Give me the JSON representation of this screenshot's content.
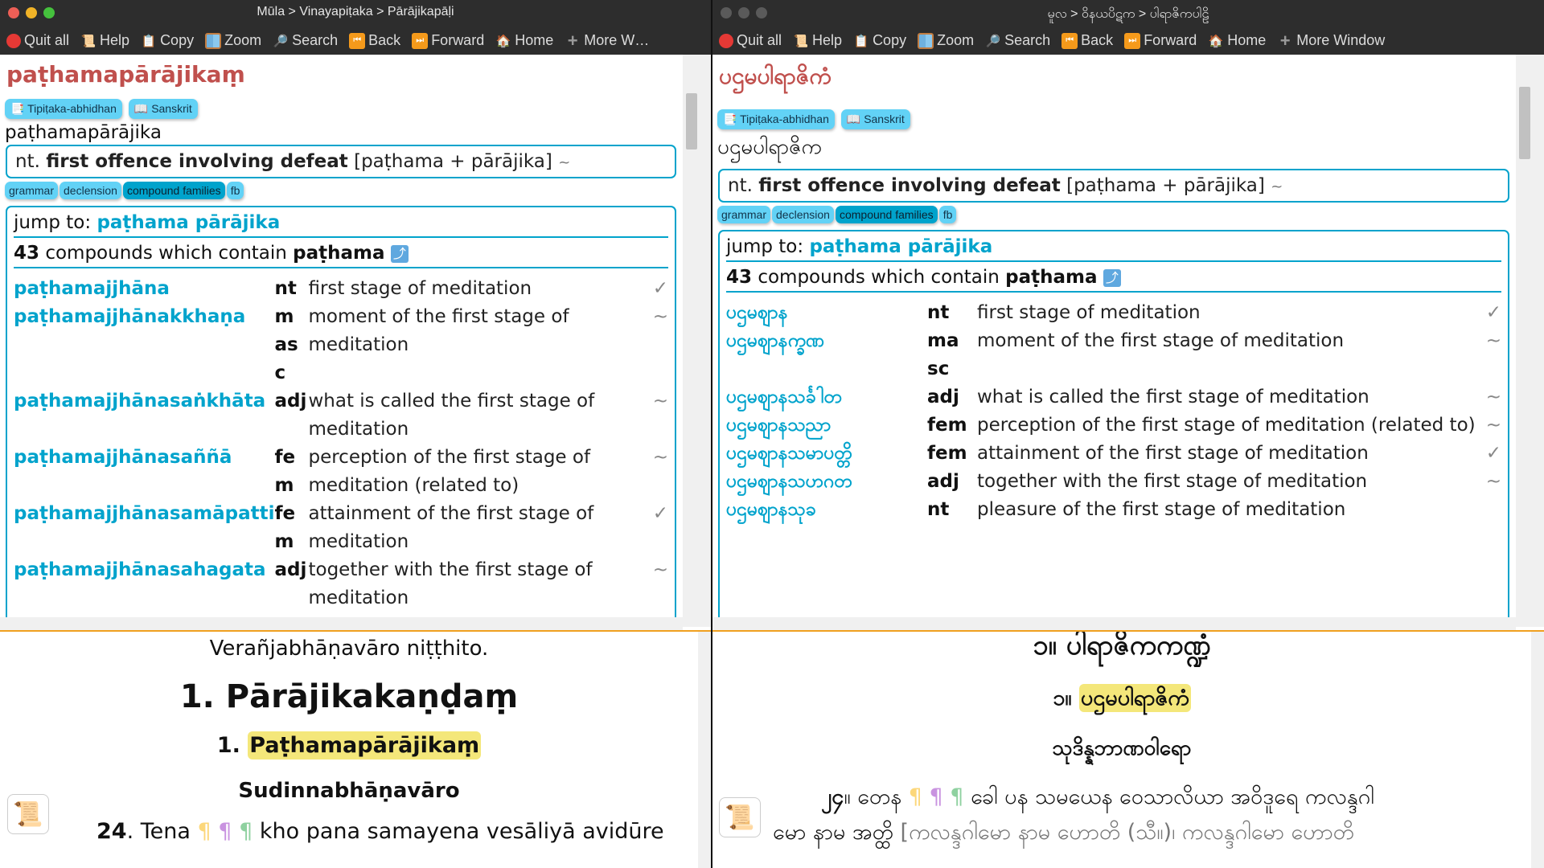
{
  "left": {
    "title": "Mūla > Vinayapiṭaka > Pārājikapāḷi",
    "toolbar": [
      "Quit all",
      "Help",
      "Copy",
      "Zoom",
      "Search",
      "Back",
      "Forward",
      "Home",
      "More W…"
    ],
    "headword": "paṭhamapārājikaṃ",
    "sources": [
      "Tipiṭaka-abhidhan",
      "Sanskrit"
    ],
    "lemma": "paṭhamapārājika",
    "meaning": {
      "pos": "nt.",
      "def": "first offence involving defeat",
      "construction": "[paṭhama + pārājika]",
      "tilde": "~"
    },
    "tabs": [
      "grammar",
      "declension",
      "compound families",
      "fb"
    ],
    "active_tab": "compound families",
    "jump_label": "jump to:",
    "jump_link": "paṭhama pārājika",
    "count": "43",
    "count_text": "compounds which contain",
    "count_word": "paṭhama",
    "compounds": [
      {
        "word": "paṭhamajjhāna",
        "pos": "nt",
        "meaning": "first stage of meditation",
        "mark": "✓"
      },
      {
        "word": "paṭhamajjhānakkhaṇa",
        "pos": "m\nas\nc",
        "meaning": "moment of the first stage of meditation",
        "mark": "~"
      },
      {
        "word": "paṭhamajjhānasaṅkhāta",
        "pos": "adj",
        "meaning": "what is called the first stage of meditation",
        "mark": "~"
      },
      {
        "word": "paṭhamajjhānasaññā",
        "pos": "fe\nm",
        "meaning": "perception of the first stage of meditation (related to)",
        "mark": "~"
      },
      {
        "word": "paṭhamajjhānasamāpatti",
        "pos": "fe\nm",
        "meaning": "attainment of the first stage of meditation",
        "mark": "✓"
      },
      {
        "word": "paṭhamajjhānasahagata",
        "pos": "adj",
        "meaning": "together with the first stage of meditation",
        "mark": "~"
      }
    ],
    "reader": {
      "line1": "Verañjabhāṇavāro niṭṭhito.",
      "h1": "1. Pārājikakaṇḍaṃ",
      "h2_num": "1.",
      "h2_hl": "Paṭhamapārājikaṃ",
      "h3": "Sudinnabhāṇavāro",
      "para_num": "24",
      "para_word": ". Tena",
      "para_rest": "kho pana samayena vesāliyā avidūre",
      "para_line2": ""
    }
  },
  "right": {
    "title": "မူလ > ဝိနယပိဋက > ပါရာဇိကပါဠိ",
    "toolbar": [
      "Quit all",
      "Help",
      "Copy",
      "Zoom",
      "Search",
      "Back",
      "Forward",
      "Home",
      "More Window"
    ],
    "headword": "ပဌမပါရာဇိကံ",
    "sources": [
      "Tipiṭaka-abhidhan",
      "Sanskrit"
    ],
    "lemma": "ပဌမပါရာဇိက",
    "meaning": {
      "pos": "nt.",
      "def": "first offence involving defeat",
      "construction": "[paṭhama + pārājika]",
      "tilde": "~"
    },
    "tabs": [
      "grammar",
      "declension",
      "compound families",
      "fb"
    ],
    "active_tab": "compound families",
    "jump_label": "jump to:",
    "jump_link": "paṭhama pārājika",
    "count": "43",
    "count_text": "compounds which contain",
    "count_word": "paṭhama",
    "compounds": [
      {
        "word": "ပဌမဈာန",
        "pos": "nt",
        "meaning": "first stage of meditation",
        "mark": "✓"
      },
      {
        "word": "ပဌမဈာနက္ခဏ",
        "pos": "ma\nsc",
        "meaning": "moment of the first stage of meditation",
        "mark": "~"
      },
      {
        "word": "ပဌမဈာနသင်္ခါတ",
        "pos": "adj",
        "meaning": "what is called the first stage of meditation",
        "mark": "~"
      },
      {
        "word": "ပဌမဈာနသညာ",
        "pos": "fem",
        "meaning": "perception of the first stage of meditation (related to)",
        "mark": "~"
      },
      {
        "word": "ပဌမဈာနသမာပတ္တိ",
        "pos": "fem",
        "meaning": "attainment of the first stage of meditation",
        "mark": "✓"
      },
      {
        "word": "ပဌမဈာနသဟဂတ",
        "pos": "adj",
        "meaning": "together with the first stage of meditation",
        "mark": "~"
      },
      {
        "word": "ပဌမဈာနသုခ",
        "pos": "nt",
        "meaning": "pleasure of the first stage of meditation",
        "mark": ""
      }
    ],
    "reader": {
      "h1": "၁။ ပါရာဇိကကဏ္ဍံ",
      "h2_num": "၁။",
      "h2_hl": "ပဌမပါရာဇိကံ",
      "h3": "သုဒိန္နဘာဏဝါရော",
      "para_num": "၂၄",
      "para_word": "။ တေန",
      "para_rest": "ခေါ ပန သမယေန ဝေသာလိယာ အဝိဒူရေ ကလန္ဒဂါ",
      "para_line2a": "မော နာမ အတ္ထိ",
      "para_line2b": "[ကလန္ဒဂါမော နာမ ဟောတိ (သီ။)၊ ကလန္ဒဂါမော ဟောတိ"
    }
  },
  "colors": {
    "accent": "#00a3cc",
    "headword": "#c0504d",
    "highlight": "#f4e77a",
    "source_btn": "#62d2f6",
    "separator": "#f0a020"
  }
}
